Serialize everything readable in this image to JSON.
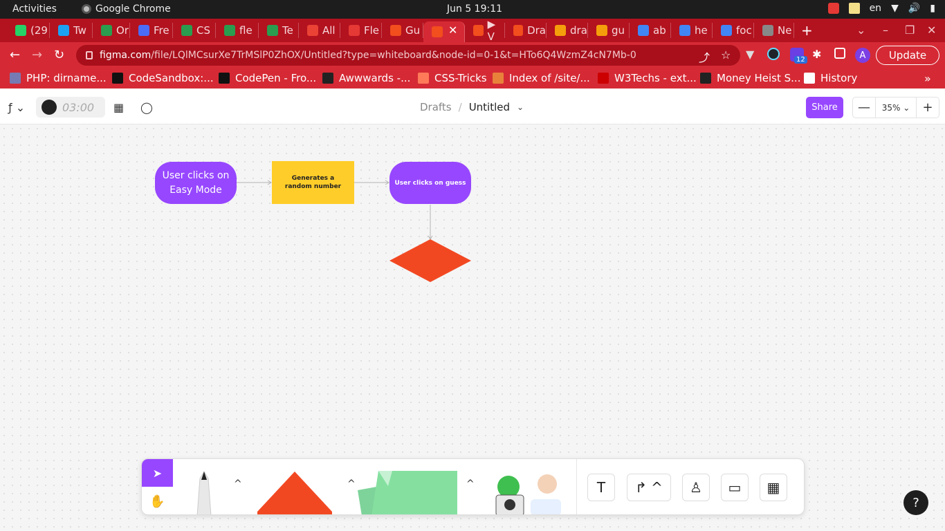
{
  "system": {
    "activities": "Activities",
    "app_name": "Google Chrome",
    "clock": "Jun 5  19:11",
    "lang": "en"
  },
  "tabs": [
    {
      "label": "(29",
      "color": "#25d366"
    },
    {
      "label": "Tw",
      "color": "#1da1f2"
    },
    {
      "label": "Or",
      "color": "#2a9d4f"
    },
    {
      "label": "Fre",
      "color": "#4a6cf7"
    },
    {
      "label": "CS",
      "color": "#2a9d4f"
    },
    {
      "label": "fle",
      "color": "#2a9d4f"
    },
    {
      "label": "Te",
      "color": "#2a9d4f"
    },
    {
      "label": "All",
      "color": "#ea4335"
    },
    {
      "label": "Fle",
      "color": "#e53935"
    },
    {
      "label": "Gu",
      "color": "#f24e1e"
    },
    {
      "label": "",
      "color": "#f24e1e",
      "active": true
    },
    {
      "label": "▶ V",
      "color": "#f24e1e"
    },
    {
      "label": "Dra",
      "color": "#f24e1e"
    },
    {
      "label": "dra",
      "color": "#f59e0b"
    },
    {
      "label": "gu",
      "color": "#f59e0b"
    },
    {
      "label": "ab",
      "color": "#4285f4"
    },
    {
      "label": "he",
      "color": "#4285f4"
    },
    {
      "label": "foc",
      "color": "#4285f4"
    },
    {
      "label": "Ne",
      "color": "#888888"
    }
  ],
  "omnibar": {
    "url_host": "figma.com",
    "url_path": "/file/LQlMCsurXe7TrMSlP0ZhOX/Untitled?type=whiteboard&node-id=0-1&t=HTo6Q4WzmZ4cN7Mb-0",
    "update_label": "Update",
    "avatar_letter": "A",
    "ext_badge": "12"
  },
  "bookmarks": [
    {
      "label": "PHP: dirname...",
      "color": "#777bb3"
    },
    {
      "label": "CodeSandbox:...",
      "color": "#111111"
    },
    {
      "label": "CodePen - Fro...",
      "color": "#111111"
    },
    {
      "label": "Awwwards -...",
      "color": "#222222"
    },
    {
      "label": "CSS-Tricks",
      "color": "#ff7a59"
    },
    {
      "label": "Index of /site/...",
      "color": "#e8823b"
    },
    {
      "label": "W3Techs - ext...",
      "color": "#cc0000"
    },
    {
      "label": "Money Heist S...",
      "color": "#222222"
    },
    {
      "label": "History",
      "color": "#ffffff"
    }
  ],
  "figma": {
    "timer": "03:00",
    "breadcrumb_drafts": "Drafts",
    "breadcrumb_sep": "/",
    "file_title": "Untitled",
    "share_label": "Share",
    "zoom_level": "35%",
    "zoom_out": "—",
    "zoom_in": "+"
  },
  "flowchart": {
    "node1": "User clicks on Easy Mode",
    "node2": "Generates a random number",
    "node3": "User clicks on guess",
    "colors": {
      "purple": "#9747ff",
      "yellow": "#ffcd29",
      "orange": "#f24822",
      "connector": "#b3b3b3"
    }
  },
  "toolbar": {
    "text_tool": "T",
    "help": "?"
  }
}
